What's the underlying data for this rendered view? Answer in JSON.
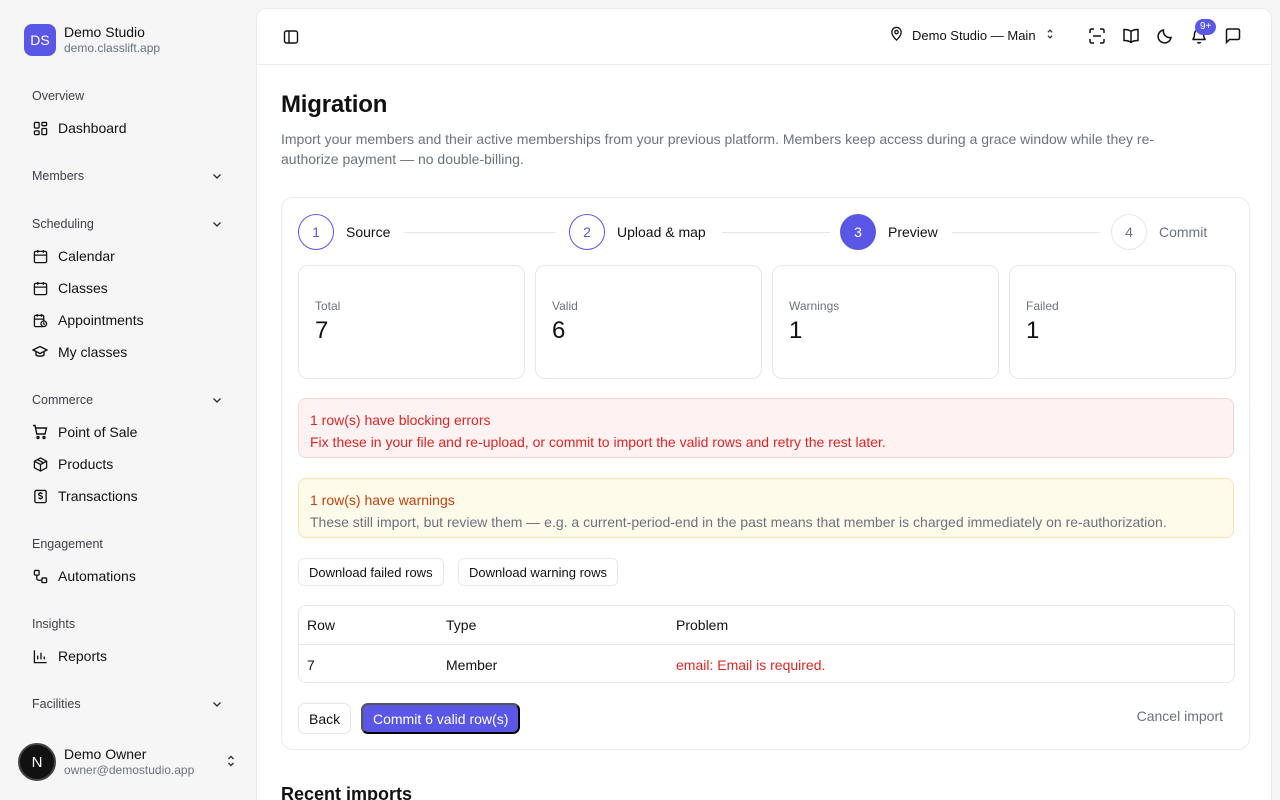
{
  "brand": {
    "initials": "DS",
    "name": "Demo Studio",
    "url": "demo.classlift.app"
  },
  "sidebar": {
    "overview_label": "Overview",
    "dashboard": "Dashboard",
    "members_label": "Members",
    "scheduling_label": "Scheduling",
    "calendar": "Calendar",
    "classes": "Classes",
    "appointments": "Appointments",
    "my_classes": "My classes",
    "commerce_label": "Commerce",
    "pos": "Point of Sale",
    "products": "Products",
    "transactions": "Transactions",
    "engagement_label": "Engagement",
    "automations": "Automations",
    "insights_label": "Insights",
    "reports": "Reports",
    "facilities_label": "Facilities"
  },
  "user": {
    "initial": "N",
    "name": "Demo Owner",
    "email": "owner@demostudio.app"
  },
  "topbar": {
    "location": "Demo Studio — Main",
    "notifications_badge": "9+"
  },
  "page": {
    "title": "Migration",
    "subtitle": "Import your members and their active memberships from your previous platform. Members keep access during a grace window while they re-authorize payment — no double-billing."
  },
  "steps": [
    {
      "number": "1",
      "label": "Source"
    },
    {
      "number": "2",
      "label": "Upload & map"
    },
    {
      "number": "3",
      "label": "Preview"
    },
    {
      "number": "4",
      "label": "Commit"
    }
  ],
  "stats": [
    {
      "label": "Total",
      "value": "7"
    },
    {
      "label": "Valid",
      "value": "6"
    },
    {
      "label": "Warnings",
      "value": "1"
    },
    {
      "label": "Failed",
      "value": "1"
    }
  ],
  "alerts": {
    "error_title": "1 row(s) have blocking errors",
    "error_desc": "Fix these in your file and re-upload, or commit to import the valid rows and retry the rest later.",
    "warn_title": "1 row(s) have warnings",
    "warn_desc": "These still import, but review them — e.g. a current-period-end in the past means that member is charged immediately on re-authorization."
  },
  "actions": {
    "download_failed": "Download failed rows",
    "download_warning": "Download warning rows",
    "back": "Back",
    "commit": "Commit 6 valid row(s)",
    "cancel": "Cancel import"
  },
  "table": {
    "headers": [
      "Row",
      "Type",
      "Problem"
    ],
    "rows": [
      {
        "row": "7",
        "type": "Member",
        "problem": "email: Email is required."
      }
    ]
  },
  "recent_title": "Recent imports"
}
